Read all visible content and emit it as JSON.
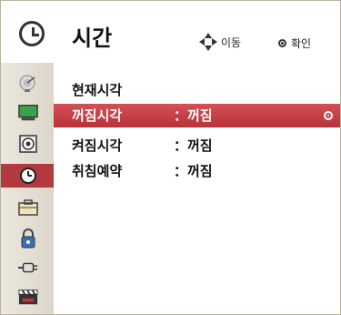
{
  "header": {
    "title": "시간",
    "hint_move": "이동",
    "hint_ok": "확인"
  },
  "sidebar": {
    "items": [
      {
        "icon": "satellite-dish-icon"
      },
      {
        "icon": "monitor-icon"
      },
      {
        "icon": "speaker-icon"
      },
      {
        "icon": "clock-icon",
        "active": true
      },
      {
        "icon": "toolbox-icon"
      },
      {
        "icon": "lock-icon"
      },
      {
        "icon": "cable-connector-icon"
      },
      {
        "icon": "clapperboard-icon"
      }
    ]
  },
  "menu": {
    "rows": [
      {
        "label": "현재시각",
        "value": ""
      },
      {
        "label": "꺼짐시각",
        "value": "：꺼짐",
        "selected": true
      },
      {
        "label": "켜짐시각",
        "value": "：꺼짐"
      },
      {
        "label": "취침예약",
        "value": "：꺼짐"
      }
    ]
  },
  "colors": {
    "accent": "#b8323a",
    "sidebar_bg": "#e4dfd4",
    "frame_bg": "#cfc7b6"
  }
}
